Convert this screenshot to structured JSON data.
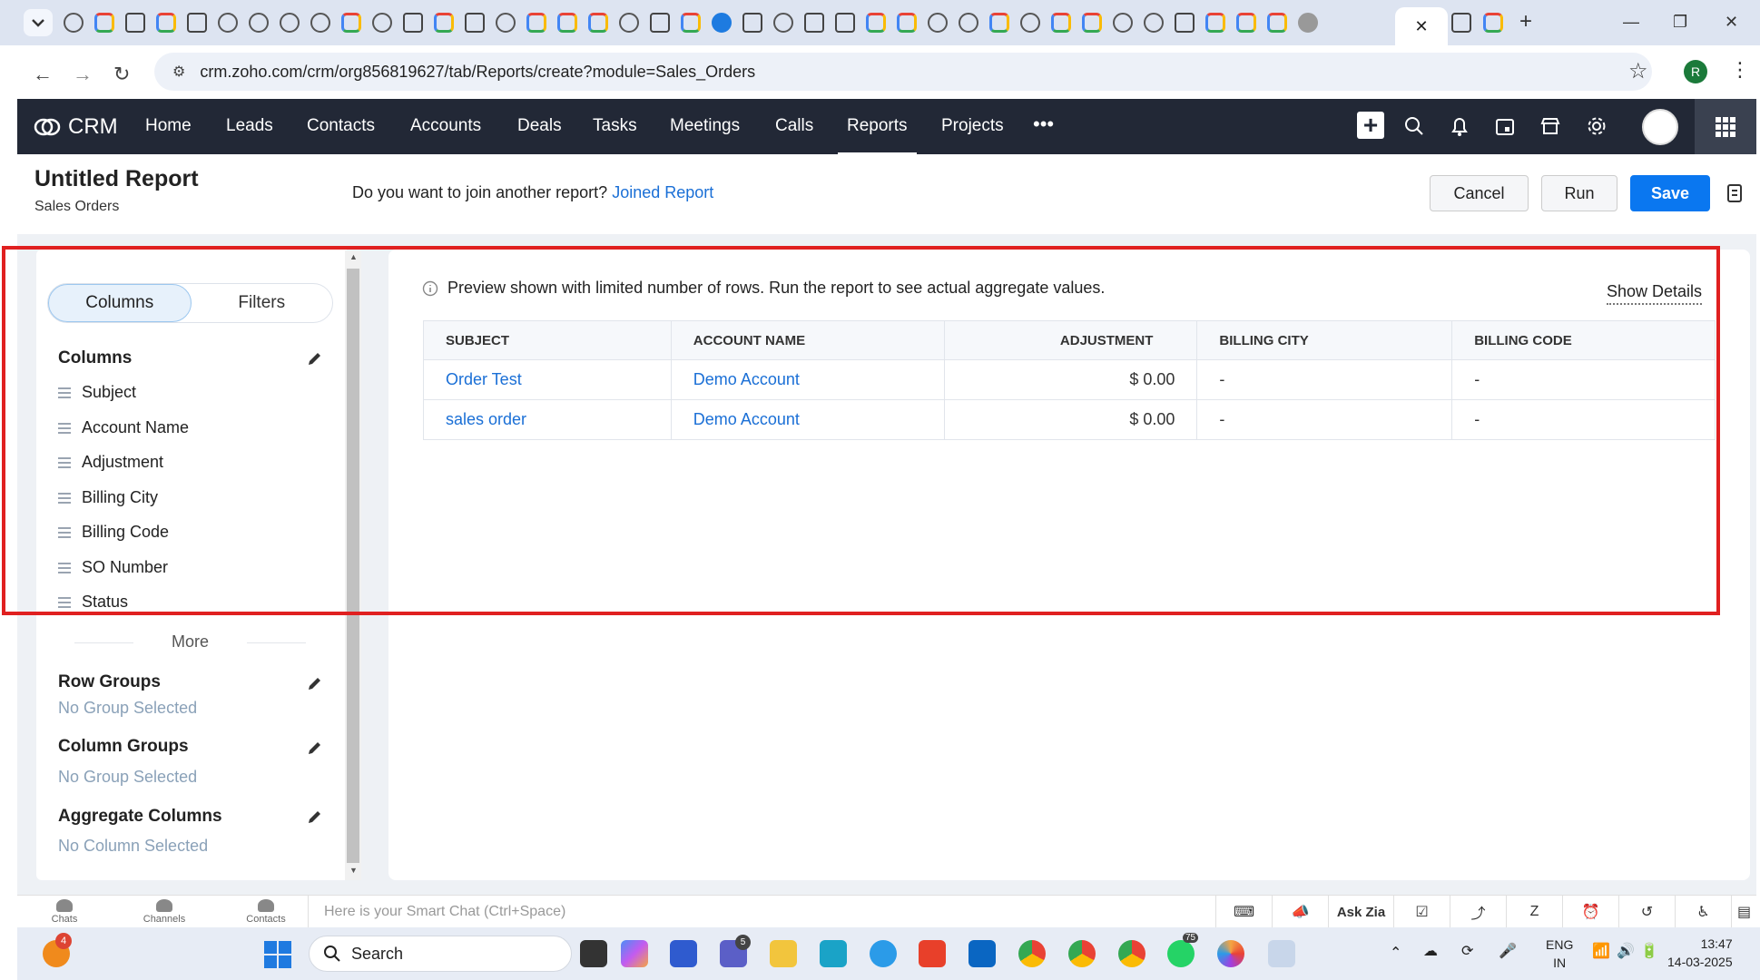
{
  "browser": {
    "url": "crm.zoho.com/crm/org856819627/tab/Reports/create?module=Sales_Orders",
    "profile_initial": "R"
  },
  "crm": {
    "logo_text": "CRM",
    "nav": [
      "Home",
      "Leads",
      "Contacts",
      "Accounts",
      "Deals",
      "Tasks",
      "Meetings",
      "Calls",
      "Reports",
      "Projects"
    ],
    "active_nav": "Reports",
    "more_label": "•••"
  },
  "report": {
    "title": "Untitled Report",
    "module": "Sales Orders",
    "join_prompt": "Do you want to join another report?",
    "join_link": "Joined Report",
    "cancel": "Cancel",
    "run": "Run",
    "save": "Save"
  },
  "left_panel": {
    "tab_columns": "Columns",
    "tab_filters": "Filters",
    "columns_title": "Columns",
    "columns": [
      "Subject",
      "Account Name",
      "Adjustment",
      "Billing City",
      "Billing Code",
      "SO Number",
      "Status"
    ],
    "more": "More",
    "row_groups_title": "Row Groups",
    "row_groups_value": "No Group Selected",
    "column_groups_title": "Column Groups",
    "column_groups_value": "No Group Selected",
    "aggregate_title": "Aggregate Columns",
    "aggregate_value": "No Column Selected"
  },
  "preview": {
    "note": "Preview shown with limited number of rows. Run the report to see actual aggregate values.",
    "show_details": "Show Details",
    "headers": [
      "SUBJECT",
      "ACCOUNT NAME",
      "ADJUSTMENT",
      "BILLING CITY",
      "BILLING CODE"
    ],
    "rows": [
      {
        "subject": "Order Test",
        "account": "Demo Account",
        "adjustment": "$ 0.00",
        "city": "-",
        "code": "-"
      },
      {
        "subject": "sales order",
        "account": "Demo Account",
        "adjustment": "$ 0.00",
        "city": "-",
        "code": "-"
      }
    ]
  },
  "chatbar": {
    "chats": "Chats",
    "channels": "Channels",
    "contacts": "Contacts",
    "placeholder": "Here is your Smart Chat (Ctrl+Space)",
    "ask_zia": "Ask Zia"
  },
  "taskbar": {
    "search": "Search",
    "lang_line1": "ENG",
    "lang_line2": "IN",
    "time": "13:47",
    "date": "14-03-2025",
    "badge_app": "4",
    "badge_teams": "5",
    "badge_whatsapp": "75"
  },
  "colors": {
    "nav_bg": "#222836",
    "accent": "#0a77f0",
    "link": "#1a6fd6",
    "highlight": "#e02020"
  }
}
